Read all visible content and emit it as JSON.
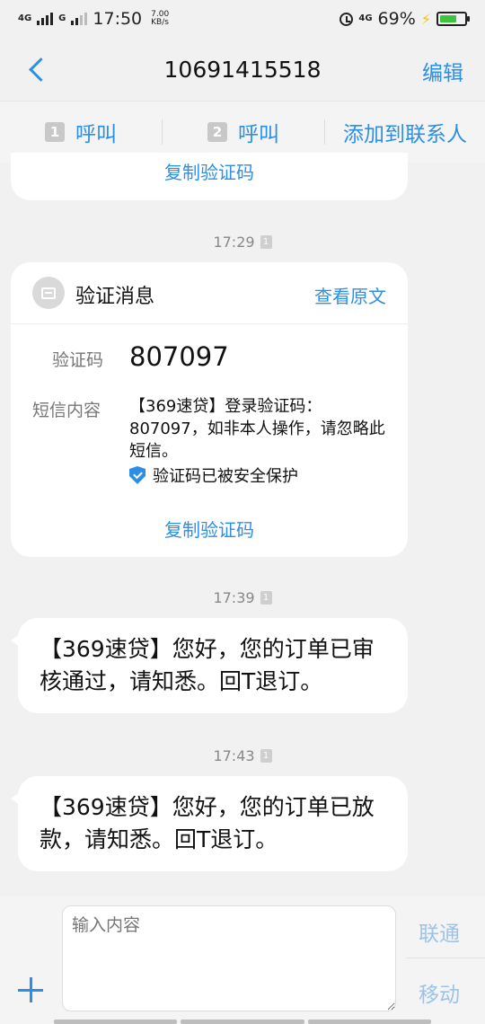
{
  "status_bar": {
    "net1": "4G",
    "net2": "G",
    "time": "17:50",
    "speed_value": "7.00",
    "speed_unit": "KB/s",
    "net3": "4G",
    "battery_percent": "69%",
    "battery_level": 0.69,
    "icons": [
      "signal-icon",
      "alarm-icon",
      "charging-icon",
      "battery-icon"
    ]
  },
  "header": {
    "back_icon": "chevron-left-icon",
    "title": "10691415518",
    "edit_label": "编辑"
  },
  "call_bar": {
    "sim1_num": "1",
    "sim1_label": "呼叫",
    "sim2_num": "2",
    "sim2_label": "呼叫",
    "add_contact_label": "添加到联系人"
  },
  "prev_card": {
    "copy_label": "复制验证码"
  },
  "messages": [
    {
      "time": "17:29",
      "sim": "1"
    },
    {
      "time": "17:39",
      "sim": "1",
      "text": "【369速贷】您好，您的订单已审核通过，请知悉。回T退订。"
    },
    {
      "time": "17:43",
      "sim": "1",
      "text": "【369速贷】您好，您的订单已放款，请知悉。回T退订。"
    }
  ],
  "verify_card": {
    "icon": "message-icon",
    "title": "验证消息",
    "view_original_label": "查看原文",
    "code_label": "验证码",
    "code_value": "807097",
    "content_label": "短信内容",
    "content_text": "【369速贷】登录验证码：807097，如非本人操作，请忽略此短信。",
    "secure_icon": "shield-check-icon",
    "secure_text": "验证码已被安全保护",
    "copy_label": "复制验证码"
  },
  "composer": {
    "plus_icon": "plus-icon",
    "placeholder": "输入内容",
    "send_unicom_label": "联通",
    "send_mobile_label": "移动"
  },
  "colors": {
    "accent": "#2c8fe6",
    "background": "#f1f1f1",
    "card": "#ffffff",
    "muted_text": "#888888",
    "send_disabled": "#9cc3ea",
    "battery_green": "#3cc43c"
  }
}
